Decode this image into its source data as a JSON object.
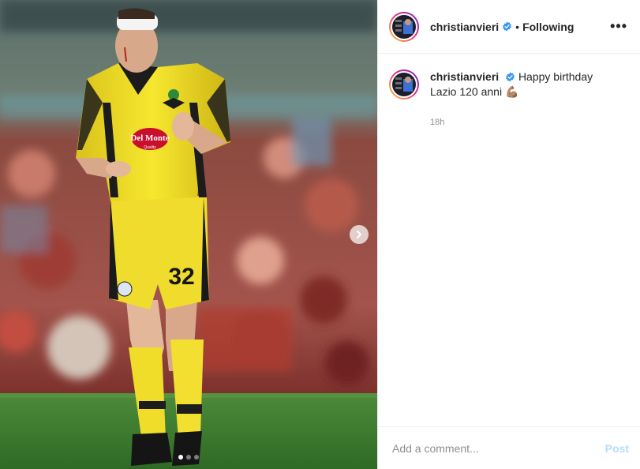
{
  "post": {
    "username": "christianvieri",
    "separator": "•",
    "follow_status": "Following",
    "more_options": "•••",
    "caption_text": "Happy birthday Lazio 120 anni",
    "caption_emoji": "💪🏽",
    "timestamp": "18h"
  },
  "media": {
    "photo_text": {
      "sponsor": "Del Monte",
      "sponsor_sub": "Quality",
      "shirt_number": "32"
    },
    "carousel": {
      "slides": 3,
      "active": 1
    },
    "next_icon": "chevron-right-icon"
  },
  "comment": {
    "placeholder": "Add a comment...",
    "post_label": "Post"
  },
  "colors": {
    "verified": "#3897f0",
    "post_disabled": "#b2dffc",
    "muted": "#8e8e8e",
    "border": "#efefef",
    "kit_yellow": "#f3e323"
  }
}
